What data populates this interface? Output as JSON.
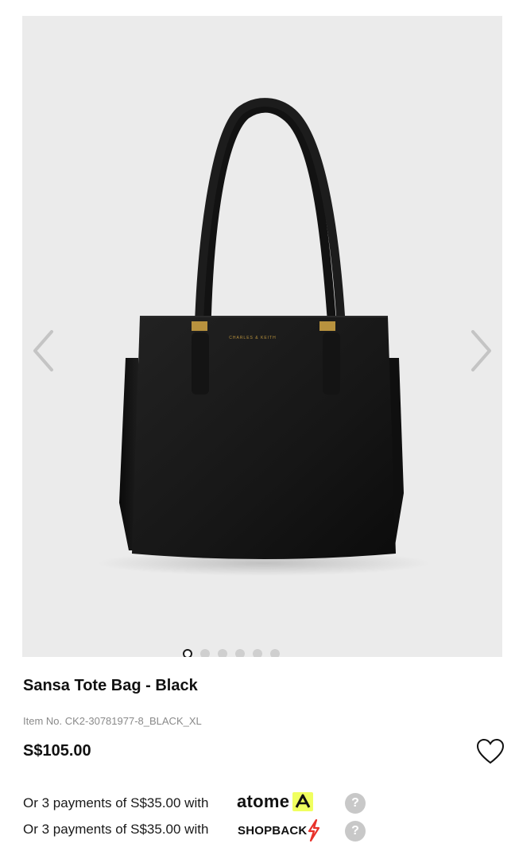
{
  "gallery": {
    "image_alt": "Black tote bag",
    "bag_brand_stamp": "CHARLES & KEITH",
    "prev_icon": "chevron-left-icon",
    "next_icon": "chevron-right-icon",
    "slide_count": 6,
    "active_slide": 1
  },
  "product": {
    "title": "Sansa Tote Bag - Black",
    "item_no": "Item No. CK2-30781977-8_BLACK_XL",
    "price": "S$105.00",
    "wishlist_icon": "heart-outline-icon"
  },
  "installments": [
    {
      "text": "Or 3 payments of S$35.00 with",
      "provider": "atome",
      "help": "?"
    },
    {
      "text": "Or 3 payments of S$35.00 with",
      "provider": "SHOPBACK",
      "help": "?"
    }
  ],
  "colors": {
    "gallery_bg": "#ebebeb",
    "atome_accent": "#f0ff5f",
    "shopback_accent": "#e8322b",
    "help_icon_bg": "#c8c8c8"
  }
}
